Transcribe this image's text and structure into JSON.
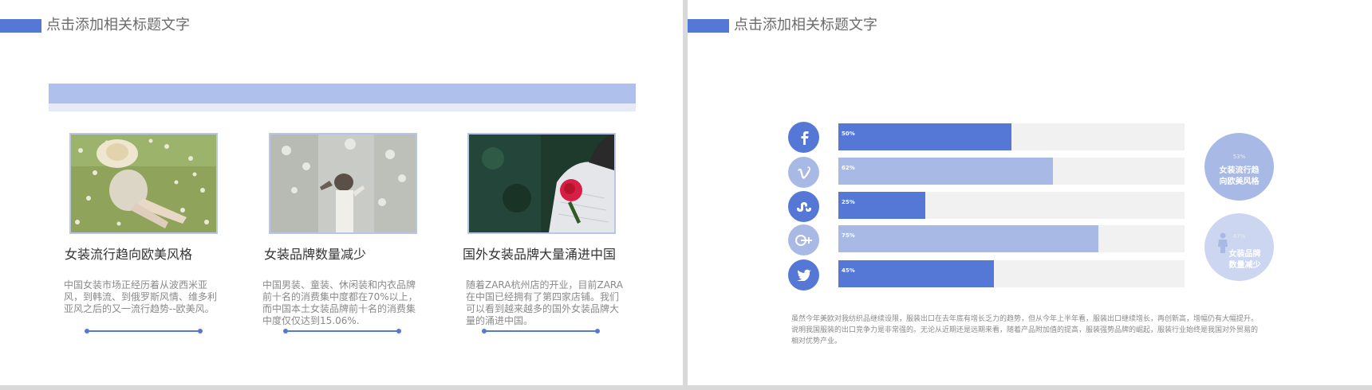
{
  "left_slide": {
    "title": "点击添加相关标题文字",
    "cards": [
      {
        "heading": "女装流行趋向欧美风格",
        "text": "中国女装市场正经历着从波西米亚风，到韩流、到俄罗斯风情、维多利亚风之后的又一流行趋势--欧美风。",
        "photo_icon": "woman-sitting-in-meadow-photo"
      },
      {
        "heading": "女装品牌数量减少",
        "text": "中国男装、童装、休闲装和内衣品牌前十名的消费集中度都在70%以上，而中国本土女装品牌前十名的消费集中度仅仅达到15.06%.",
        "photo_icon": "woman-walking-in-forest-photo"
      },
      {
        "heading": "国外女装品牌大量涌进中国",
        "text": "随着ZARA杭州店的开业，目前ZARA在中国已经拥有了第四家店铺。我们可以看到越来越多的国外女装品牌大量的涌进中国。",
        "photo_icon": "woman-holding-red-rose-photo"
      }
    ]
  },
  "right_slide": {
    "title": "点击添加相关标题文字",
    "colors": {
      "dark": "#5578d6",
      "light": "#a9b9e6",
      "track": "#f1f1f1"
    },
    "bars": [
      {
        "icon": "facebook-icon",
        "label": "50%",
        "value": 50,
        "tone": "dark"
      },
      {
        "icon": "vimeo-icon",
        "label": "62%",
        "value": 62,
        "tone": "light"
      },
      {
        "icon": "stumbleupon-icon",
        "label": "25%",
        "value": 25,
        "tone": "dark"
      },
      {
        "icon": "google-plus-icon",
        "label": "75%",
        "value": 75,
        "tone": "light"
      },
      {
        "icon": "twitter-icon",
        "label": "45%",
        "value": 45,
        "tone": "dark"
      }
    ],
    "bubbles": [
      {
        "pct": "53%",
        "line1": "女装流行趋",
        "line2": "向欧美风格",
        "icon": "female-figure-icon"
      },
      {
        "pct": "47%",
        "line1": "女装品牌",
        "line2": "数量减少",
        "icon": "female-figure-icon"
      }
    ],
    "summary": "虽然今年美欧对我纺织品继续设限，服装出口在去年底有增长乏力的趋势，但从今年上半年看，服装出口继续增长，再创新高，增幅仍有大幅提升。说明我国服装的出口竞争力是非常强的。无论从近期还是远期来看，随着产品附加值的提高，服装强势品牌的崛起，服装行业始终是我国对外贸易的相对优势产业。"
  }
}
